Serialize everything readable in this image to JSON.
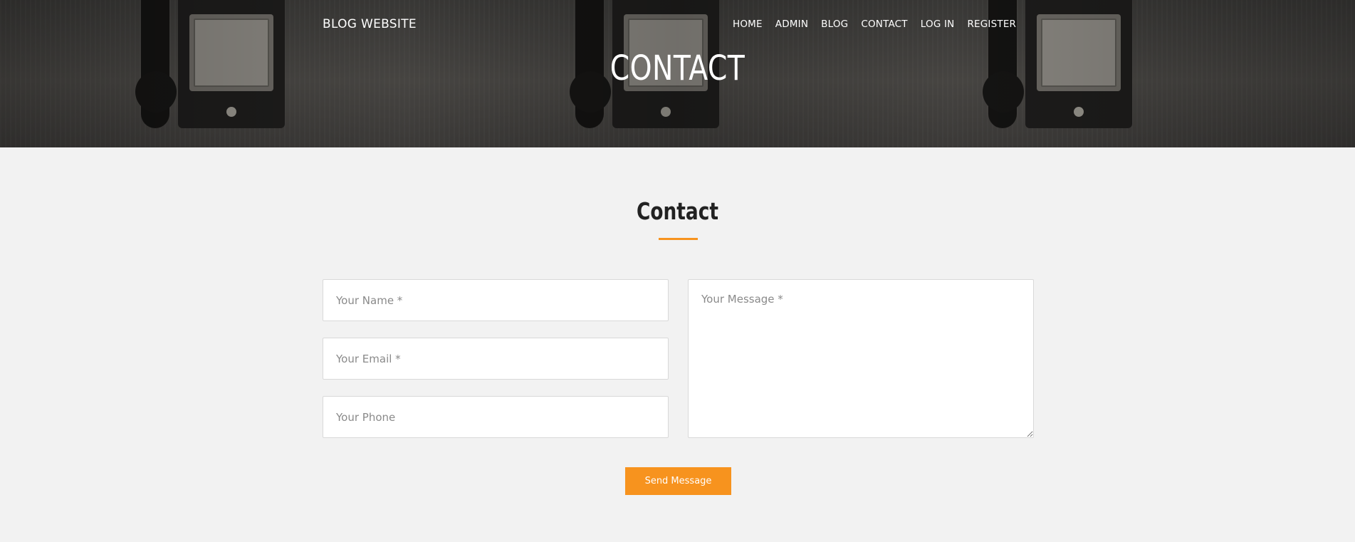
{
  "brand": "BLOG WEBSITE",
  "nav": [
    {
      "label": "HOME"
    },
    {
      "label": "ADMIN"
    },
    {
      "label": "BLOG"
    },
    {
      "label": "CONTACT"
    },
    {
      "label": "LOG IN"
    },
    {
      "label": "REGISTER"
    }
  ],
  "hero": {
    "title": "CONTACT"
  },
  "section": {
    "title": "Contact"
  },
  "form": {
    "name_placeholder": "Your Name *",
    "email_placeholder": "Your Email *",
    "phone_placeholder": "Your Phone",
    "message_placeholder": "Your Message *",
    "submit_label": "Send Message"
  },
  "colors": {
    "accent": "#f7931e",
    "background": "#f2f2f2"
  }
}
